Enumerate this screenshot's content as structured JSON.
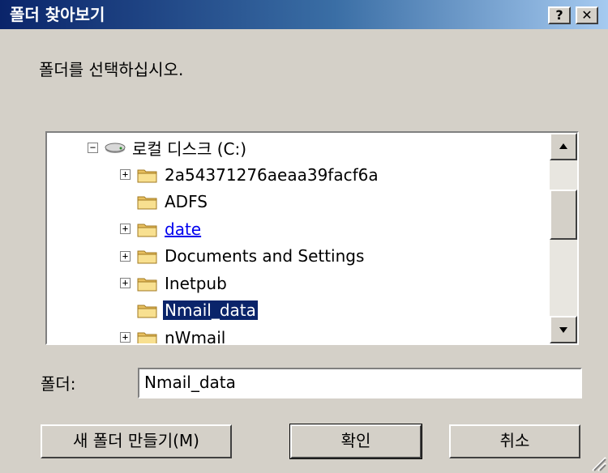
{
  "window": {
    "title": "폴더 찾아보기",
    "help_label": "?",
    "close_label": "✕"
  },
  "prompt": "폴더를 선택하십시오.",
  "tree": {
    "items": [
      {
        "label": "로컬 디스크 (C:)",
        "icon": "drive-icon",
        "expander": "⊟",
        "level": 0,
        "style": "normal"
      },
      {
        "label": "2a54371276aeaa39facf6a",
        "icon": "folder-icon",
        "expander": "+",
        "level": 1,
        "style": "normal"
      },
      {
        "label": "ADFS",
        "icon": "folder-icon",
        "expander": "",
        "level": 1,
        "style": "normal"
      },
      {
        "label": "date",
        "icon": "folder-icon",
        "expander": "+",
        "level": 1,
        "style": "link"
      },
      {
        "label": "Documents and Settings",
        "icon": "folder-icon",
        "expander": "+",
        "level": 1,
        "style": "normal"
      },
      {
        "label": "Inetpub",
        "icon": "folder-icon",
        "expander": "+",
        "level": 1,
        "style": "normal"
      },
      {
        "label": "Nmail_data",
        "icon": "folder-icon",
        "expander": "",
        "level": 1,
        "style": "selected"
      },
      {
        "label": "nWmail",
        "icon": "folder-icon",
        "expander": "+",
        "level": 1,
        "style": "normal"
      }
    ]
  },
  "folder_field": {
    "label": "폴더:",
    "value": "Nmail_data"
  },
  "buttons": {
    "new_folder": "새 폴더 만들기(M)",
    "ok": "확인",
    "cancel": "취소"
  },
  "colors": {
    "titlebar_start": "#0a246a",
    "titlebar_end": "#a6caf0",
    "face": "#d4d0c8",
    "selection": "#0a246a",
    "link": "#0000ee"
  }
}
